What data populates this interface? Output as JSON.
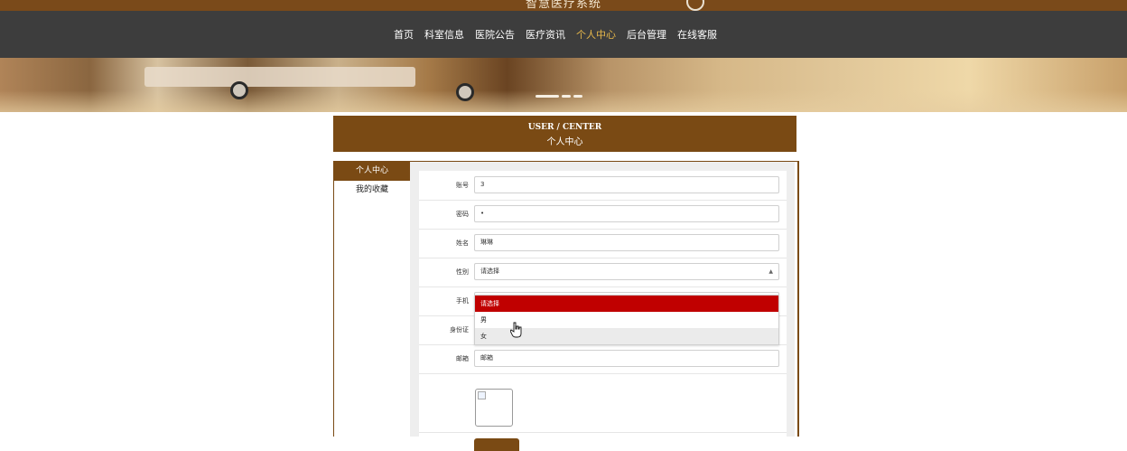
{
  "app": {
    "title": "智慧医疗系统"
  },
  "nav": {
    "items": [
      {
        "label": "首页"
      },
      {
        "label": "科室信息"
      },
      {
        "label": "医院公告"
      },
      {
        "label": "医疗资讯"
      },
      {
        "label": "个人中心",
        "active": true
      },
      {
        "label": "后台管理"
      },
      {
        "label": "在线客服"
      }
    ]
  },
  "section": {
    "title_en": "USER / CENTER",
    "title_cn": "个人中心"
  },
  "sidebar": {
    "items": [
      {
        "label": "个人中心",
        "active": true
      },
      {
        "label": "我的收藏"
      }
    ]
  },
  "form": {
    "account": {
      "label": "账号",
      "value": "3"
    },
    "password": {
      "label": "密码",
      "value": "•"
    },
    "name": {
      "label": "姓名",
      "value": "琳琳"
    },
    "gender": {
      "label": "性别",
      "value": "请选择",
      "options": [
        "请选择",
        "男",
        "女"
      ],
      "highlighted": "请选择",
      "hover": "女"
    },
    "phone": {
      "label": "手机"
    },
    "idcard": {
      "label": "身份证"
    },
    "email": {
      "label": "邮箱",
      "value": "邮箱"
    }
  },
  "colors": {
    "brand": "#7a4a14",
    "nav_bg": "#3d3d3d",
    "nav_active": "#e8b84a",
    "option_selected": "#c00000"
  }
}
